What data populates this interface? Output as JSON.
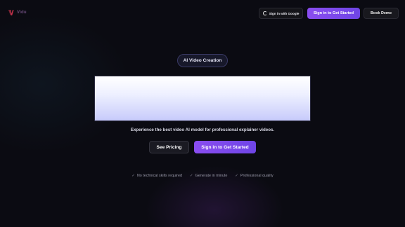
{
  "header": {
    "logo_text": "Vidu",
    "google_button_label": "Sign in with Google",
    "signin_button_label": "Sign in to Get Started",
    "demo_button_label": "Book Demo"
  },
  "hero": {
    "badge": "AI Video Creation",
    "subtitle": "Experience the best video AI model for professional explainer videos.",
    "pricing_button_label": "See Pricing",
    "signin_button_label": "Sign in to Get Started"
  },
  "features": [
    {
      "icon": "check-icon",
      "label": "No technical skills required"
    },
    {
      "icon": "check-icon",
      "label": "Generate in minute"
    },
    {
      "icon": "check-icon",
      "label": "Professional quality"
    }
  ],
  "colors": {
    "background": "#0b0b12",
    "accent": "#7b4ae8",
    "logo": "#c0314a"
  }
}
